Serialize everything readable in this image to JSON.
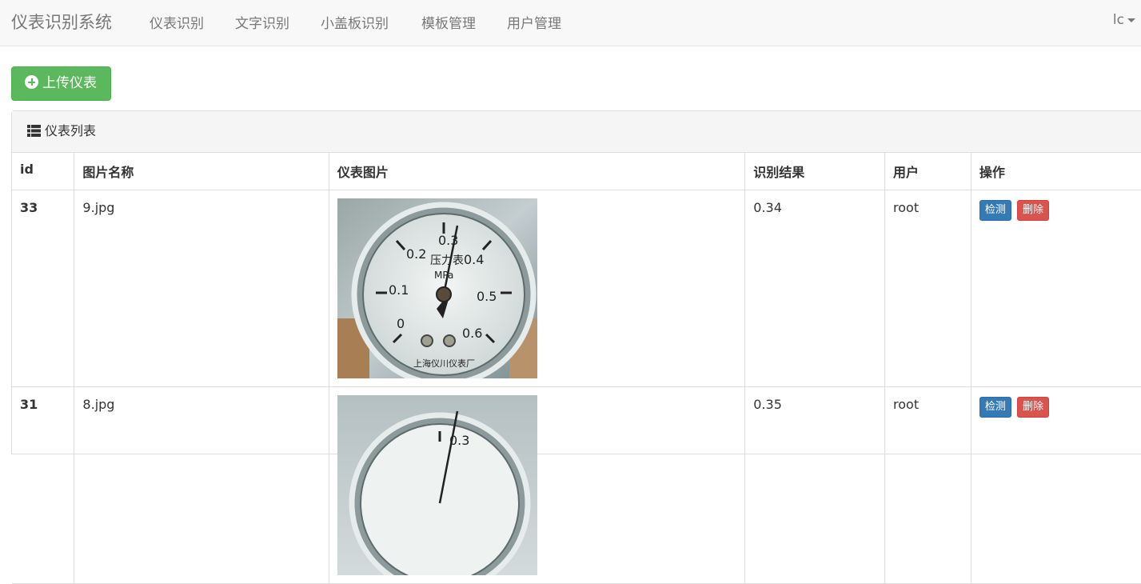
{
  "navbar": {
    "brand": "仪表识别系统",
    "items": [
      "仪表识别",
      "文字识别",
      "小盖板识别",
      "模板管理",
      "用户管理"
    ],
    "user": "lc"
  },
  "upload_button": "上传仪表",
  "panel": {
    "title": "仪表列表",
    "columns": [
      "id",
      "图片名称",
      "仪表图片",
      "识别结果",
      "用户",
      "操作"
    ]
  },
  "rows": [
    {
      "id": "33",
      "name": "9.jpg",
      "result": "0.34",
      "user": "root",
      "detect_label": "检测",
      "delete_label": "删除",
      "gauge": {
        "scale": [
          "0",
          "0.1",
          "0.2",
          "0.3",
          "0.4",
          "0.5",
          "0.6"
        ],
        "face_text": "压力表",
        "unit": "MPa",
        "maker": "上海仪川仪表厂"
      }
    },
    {
      "id": "31",
      "name": "8.jpg",
      "result": "0.35",
      "user": "root",
      "detect_label": "检测",
      "delete_label": "删除",
      "gauge": {
        "scale": [
          "0.3"
        ]
      }
    }
  ]
}
